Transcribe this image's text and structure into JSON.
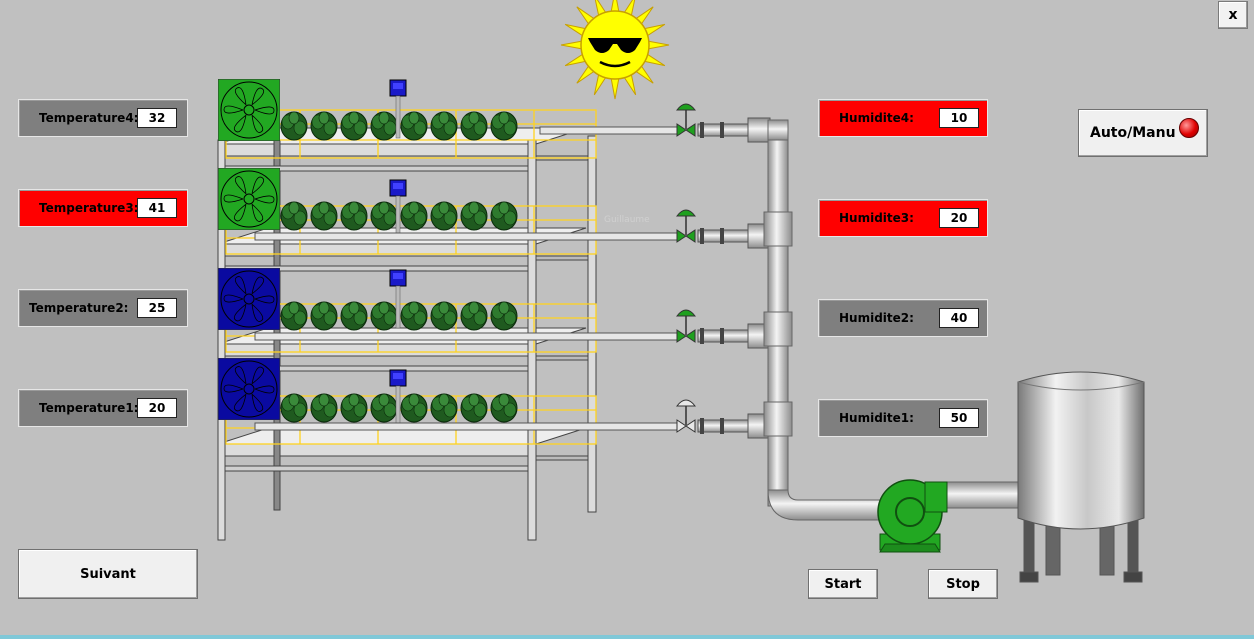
{
  "window": {
    "close_label": "x"
  },
  "temperatures": [
    {
      "label": "Temperature4:",
      "value": "32",
      "status": "normal"
    },
    {
      "label": "Temperature3:",
      "value": "41",
      "status": "alarm"
    },
    {
      "label": "Temperature2:",
      "value": "25",
      "status": "normal"
    },
    {
      "label": "Temperature1:",
      "value": "20",
      "status": "normal"
    }
  ],
  "humidities": [
    {
      "label": "Humidite4:",
      "value": "10",
      "status": "alarm"
    },
    {
      "label": "Humidite3:",
      "value": "20",
      "status": "alarm"
    },
    {
      "label": "Humidite2:",
      "value": "40",
      "status": "normal"
    },
    {
      "label": "Humidite1:",
      "value": "50",
      "status": "normal"
    }
  ],
  "controls": {
    "auto_manu_label": "Auto/Manu",
    "auto_manu_indicator": "red",
    "suivant_label": "Suivant",
    "start_label": "Start",
    "stop_label": "Stop"
  },
  "fans": [
    {
      "level": 4,
      "state": "on",
      "color": "#22a822"
    },
    {
      "level": 3,
      "state": "on",
      "color": "#22a822"
    },
    {
      "level": 2,
      "state": "off",
      "color": "#0a0aa0"
    },
    {
      "level": 1,
      "state": "off",
      "color": "#0a0aa0"
    }
  ],
  "valves": [
    {
      "level": 4,
      "state": "open",
      "color": "#1fa01f"
    },
    {
      "level": 3,
      "state": "open",
      "color": "#1fa01f"
    },
    {
      "level": 2,
      "state": "open",
      "color": "#1fa01f"
    },
    {
      "level": 1,
      "state": "closed",
      "color": "#e8e8e8"
    }
  ],
  "colors": {
    "background": "#c0c0c0",
    "alarm": "#ff0000",
    "normal_panel": "#7f7f7f",
    "pump": "#22a822",
    "sun": "#ffff00"
  },
  "icons": {
    "sun": "sun-with-sunglasses-icon",
    "fan": "fan-icon",
    "sensor_probe": "probe-sensor-icon",
    "valve": "valve-icon",
    "pump": "pump-icon",
    "tank": "tank-icon",
    "plant": "plant-icon"
  }
}
